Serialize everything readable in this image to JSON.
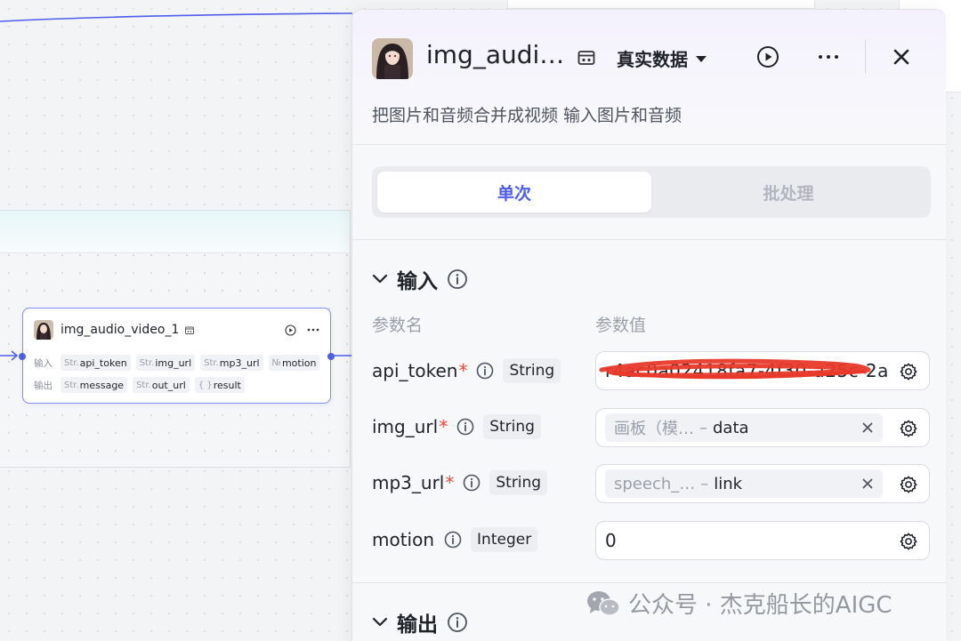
{
  "node": {
    "title": "img_audio_video_1",
    "inputs_label": "输入",
    "outputs_label": "输出",
    "inputs": [
      {
        "type": "Str.",
        "name": "api_token"
      },
      {
        "type": "Str.",
        "name": "img_url"
      },
      {
        "type": "Str.",
        "name": "mp3_url"
      },
      {
        "type": "№",
        "name": "motion"
      }
    ],
    "outputs": [
      {
        "type": "Str.",
        "name": "message"
      },
      {
        "type": "Str.",
        "name": "out_url"
      },
      {
        "type": "{ }",
        "name": "result"
      }
    ]
  },
  "panel": {
    "title": "img_audi…",
    "mode": "真实数据",
    "description": "把图片和音频合并成视频 输入图片和音频",
    "tabs": [
      {
        "label": "单次",
        "active": true
      },
      {
        "label": "批处理",
        "active": false
      }
    ],
    "input_section": "输入",
    "output_section": "输出",
    "col_name": "参数名",
    "col_value": "参数值",
    "params": [
      {
        "name": "api_token",
        "required": "*",
        "type": "String",
        "value": "r4ac0a02418fa7-4f30-a25c-2a",
        "value_redacted": true
      },
      {
        "name": "img_url",
        "required": "*",
        "type": "String",
        "ref_source": "画板（模…",
        "ref_field": "data"
      },
      {
        "name": "mp3_url",
        "required": "*",
        "type": "String",
        "ref_source": "speech_…",
        "ref_field": "link"
      },
      {
        "name": "motion",
        "required": "",
        "type": "Integer",
        "value": "0"
      }
    ]
  },
  "watermark": "公众号 · 杰克船长的AIGC",
  "colors": {
    "accent": "#4e5dea",
    "required": "#f04b3e",
    "redaction": "#e8392a"
  }
}
